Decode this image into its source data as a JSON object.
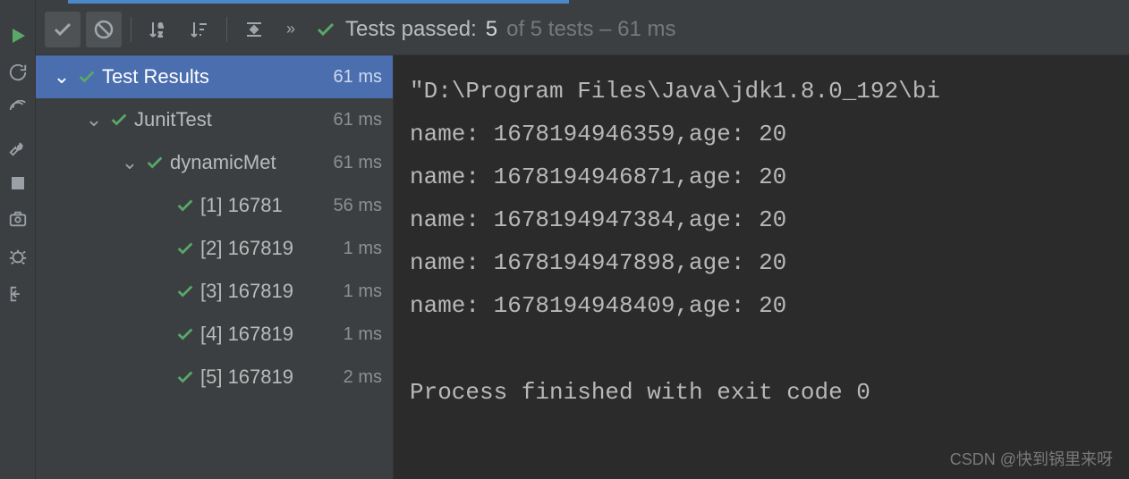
{
  "toolbar": {
    "status_prefix": "Tests passed:",
    "status_count": "5",
    "status_suffix": "of 5 tests – 61 ms"
  },
  "tree": {
    "root": {
      "label": "Test Results",
      "time": "61 ms"
    },
    "suite": {
      "label": "JunitTest",
      "time": "61 ms"
    },
    "method": {
      "label": "dynamicMet",
      "time": "61 ms"
    },
    "tests": [
      {
        "label": "[1] 16781",
        "time": "56 ms"
      },
      {
        "label": "[2] 167819",
        "time": "1 ms"
      },
      {
        "label": "[3] 167819",
        "time": "1 ms"
      },
      {
        "label": "[4] 167819",
        "time": "1 ms"
      },
      {
        "label": "[5] 167819",
        "time": "2 ms"
      }
    ]
  },
  "console": {
    "path": "\"D:\\Program Files\\Java\\jdk1.8.0_192\\bi",
    "lines": [
      "name: 1678194946359,age: 20",
      "name: 1678194946871,age: 20",
      "name: 1678194947384,age: 20",
      "name: 1678194947898,age: 20",
      "name: 1678194948409,age: 20"
    ],
    "exit": "Process finished with exit code 0"
  },
  "watermark": "CSDN @快到锅里来呀"
}
